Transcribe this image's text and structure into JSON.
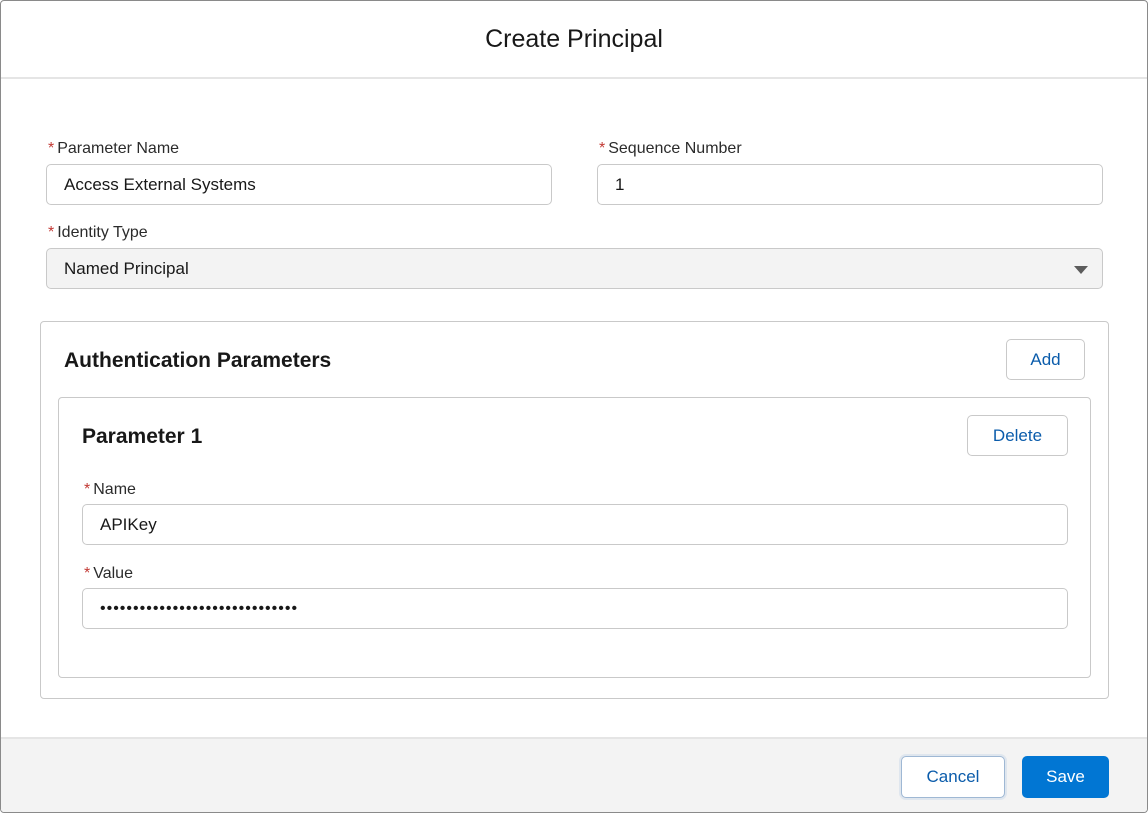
{
  "modal": {
    "title": "Create Principal"
  },
  "form": {
    "required_marker": "*",
    "parameter_name": {
      "label": "Parameter Name",
      "value": "Access External Systems"
    },
    "sequence_number": {
      "label": "Sequence Number",
      "value": "1"
    },
    "identity_type": {
      "label": "Identity Type",
      "selected": "Named Principal"
    }
  },
  "auth_section": {
    "title": "Authentication Parameters",
    "add_label": "Add",
    "parameters": [
      {
        "title": "Parameter 1",
        "delete_label": "Delete",
        "name": {
          "label": "Name",
          "value": "APIKey"
        },
        "value": {
          "label": "Value",
          "masked_value": "••••••••••••••••••••••••••••••"
        }
      }
    ]
  },
  "footer": {
    "cancel_label": "Cancel",
    "save_label": "Save"
  },
  "colors": {
    "accent": "#0176d3",
    "link": "#0b5cab",
    "required": "#c23934"
  }
}
